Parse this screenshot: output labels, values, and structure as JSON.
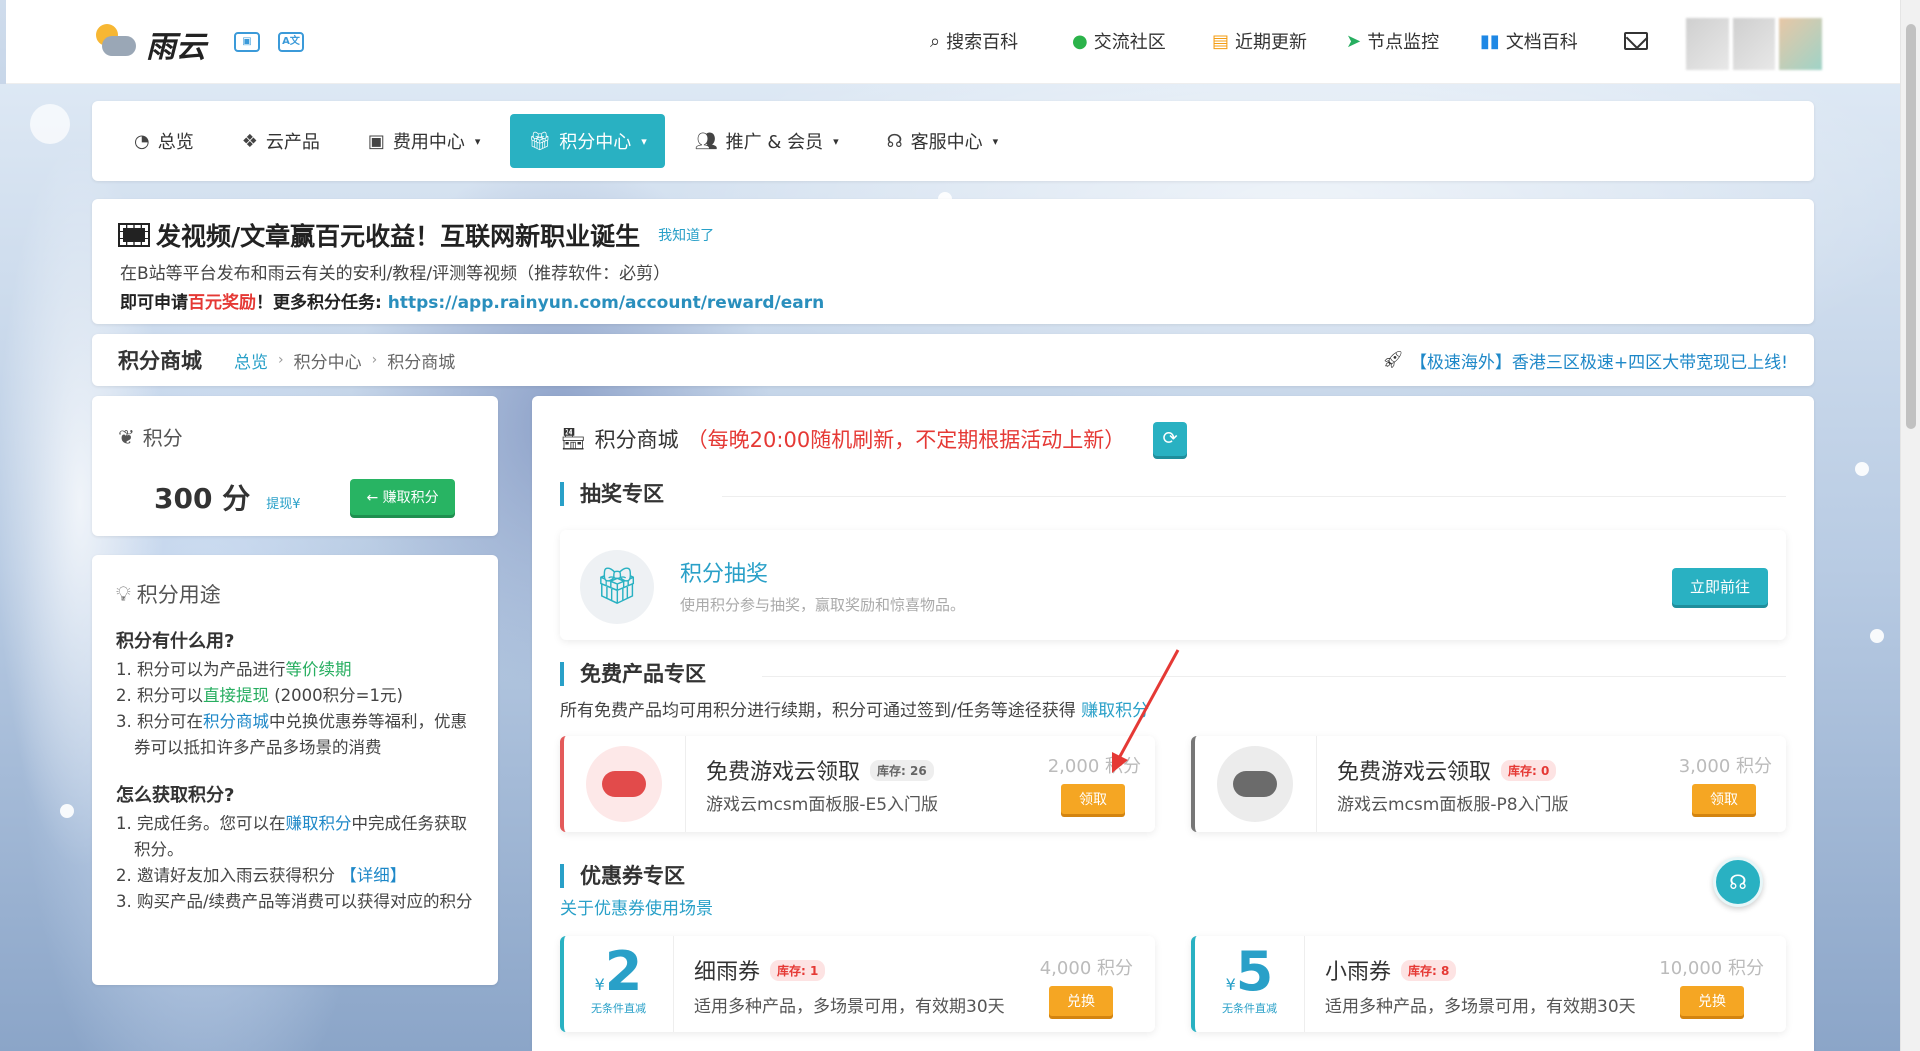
{
  "topbar": {
    "logo_text": "雨云",
    "nav": [
      {
        "icon": "search-icon",
        "label": "搜索百科"
      },
      {
        "icon": "wechat-icon",
        "label": "交流社区"
      },
      {
        "icon": "news-icon",
        "label": "近期更新"
      },
      {
        "icon": "location-arrow-icon",
        "label": "节点监控"
      },
      {
        "icon": "book-icon",
        "label": "文档百科"
      }
    ]
  },
  "mainnav": {
    "items": [
      {
        "label": "总览",
        "caret": ""
      },
      {
        "label": "云产品",
        "caret": ""
      },
      {
        "label": "费用中心",
        "caret": "▾"
      },
      {
        "label": "积分中心",
        "caret": "▾",
        "active": true
      },
      {
        "label": "推广 & 会员",
        "caret": "▾"
      },
      {
        "label": "客服中心",
        "caret": "▾"
      }
    ]
  },
  "announcement": {
    "title": "发视频/文章赢百元收益！互联网新职业诞生",
    "dismiss": "我知道了",
    "line1": "在B站等平台发布和雨云有关的安利/教程/评测等视频（推荐软件：必剪）",
    "line2_prefix": "即可申请",
    "line2_red": "百元奖励",
    "line2_mid": "！更多积分任务: ",
    "line2_link": "https://app.rainyun.com/account/reward/earn"
  },
  "breadcrumb": {
    "title": "积分商城",
    "items": [
      "总览",
      "积分中心",
      "积分商城"
    ],
    "notice": "【极速海外】香港三区极速+四区大带宽现已上线!"
  },
  "points": {
    "label": "积分",
    "value": "300 分",
    "withdraw": "提现¥",
    "earn_button": "← 赚取积分"
  },
  "usage": {
    "title": "积分用途",
    "q1": "积分有什么用?",
    "q1_items": [
      {
        "prefix": "1. 积分可以为产品进行",
        "hl": "等价续期",
        "suffix": ""
      },
      {
        "prefix": "2. 积分可以",
        "hl": "直接提现",
        "suffix": " (2000积分=1元)"
      },
      {
        "prefix": "3. 积分可在",
        "hl": "积分商城",
        "suffix": "中兑换优惠券等福利，优惠券可以抵扣许多产品多场景的消费"
      }
    ],
    "q2": "怎么获取积分?",
    "q2_items": [
      {
        "prefix": "1. 完成任务。您可以在",
        "hl": "赚取积分",
        "suffix": "中完成任务获取积分。"
      },
      {
        "prefix": "2. 邀请好友加入雨云获得积分 ",
        "hl": "【详细】",
        "suffix": ""
      },
      {
        "prefix": "3. 购买产品/续费产品等消费可以获得对应的积分",
        "hl": "",
        "suffix": ""
      }
    ]
  },
  "shop": {
    "title": "积分商城",
    "note": "（每晚20:00随机刷新，不定期根据活动上新）",
    "lottery_section": "抽奖专区",
    "lottery": {
      "title": "积分抽奖",
      "desc": "使用积分参与抽奖，赢取奖励和惊喜物品。",
      "button": "立即前往"
    },
    "free_section": "免费产品专区",
    "free_sub_prefix": "所有免费产品均可用积分进行续期，积分可通过签到/任务等途径获得 ",
    "free_sub_link": "赚取积分",
    "products": [
      {
        "name": "免费游戏云领取",
        "stock": "库存: 26",
        "desc": "游戏云mcsm面板服-E5入门版",
        "price": "2,000 积分",
        "button": "领取"
      },
      {
        "name": "免费游戏云领取",
        "stock": "库存: 0",
        "desc": "游戏云mcsm面板服-P8入门版",
        "price": "3,000 积分",
        "button": "领取"
      }
    ],
    "coupon_section": "优惠券专区",
    "coupon_sub": "关于优惠券使用场景",
    "coupons": [
      {
        "yen": "¥",
        "amount": "2",
        "tag": "无条件直减",
        "name": "细雨券",
        "stock": "库存: 1",
        "desc": "适用多种产品，多场景可用，有效期30天",
        "price": "4,000 积分",
        "button": "兑换"
      },
      {
        "yen": "¥",
        "amount": "5",
        "tag": "无条件直减",
        "name": "小雨券",
        "stock": "库存: 8",
        "desc": "适用多种产品，多场景可用，有效期30天",
        "price": "10,000 积分",
        "button": "兑换"
      }
    ]
  },
  "colors": {
    "accent": "#29b1c2",
    "link": "#29a0c8",
    "red": "#e53935",
    "orange": "#f5a623",
    "green": "#28b463"
  }
}
